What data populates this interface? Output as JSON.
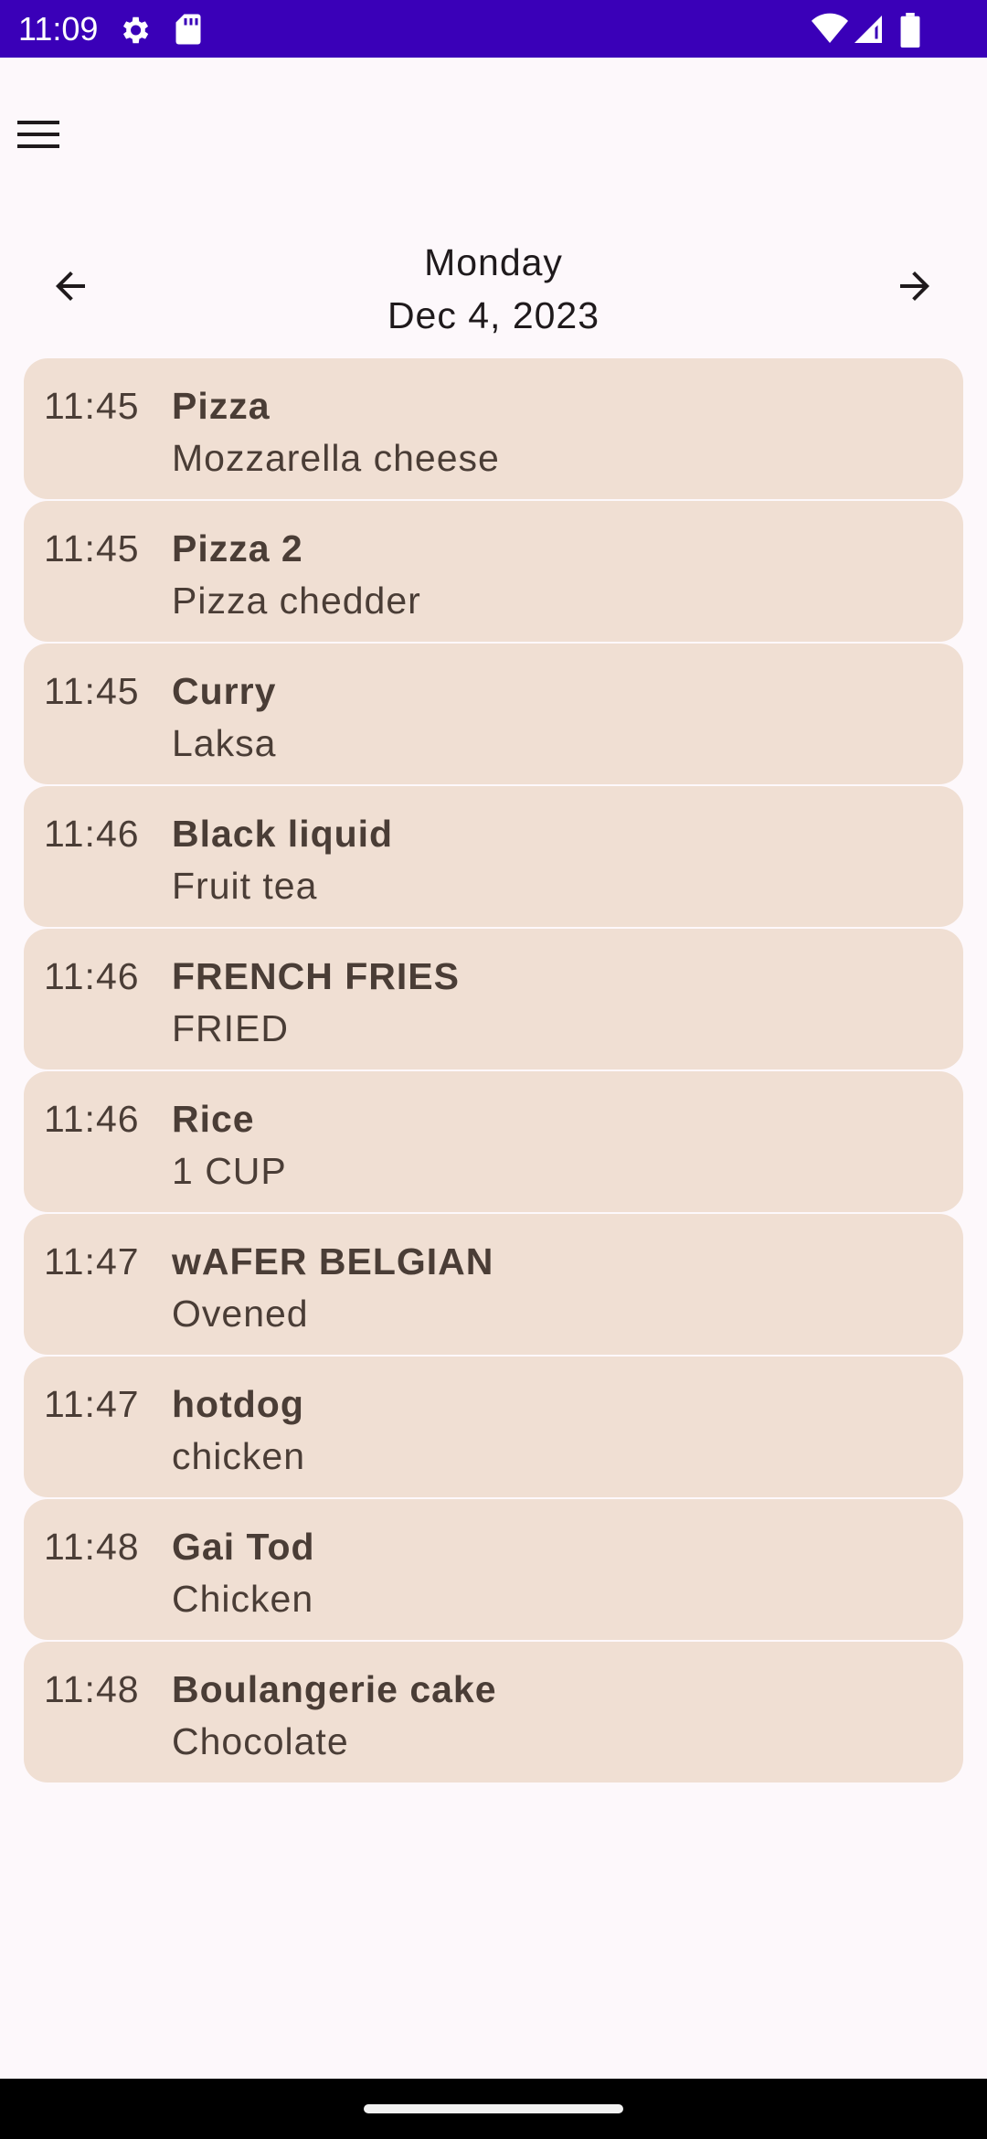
{
  "status_bar": {
    "time": "11:09",
    "icons": [
      "settings-gear-icon",
      "sd-card-icon",
      "wifi-icon",
      "cell-signal-icon",
      "battery-icon"
    ],
    "background": "#3a00b8"
  },
  "toolbar": {
    "menu_icon": "hamburger-menu-icon"
  },
  "date_nav": {
    "day": "Monday",
    "date": "Dec 4, 2023",
    "prev_icon": "arrow-back-icon",
    "next_icon": "arrow-forward-icon"
  },
  "entries": [
    {
      "time": "11:45",
      "title": "Pizza",
      "subtitle": "Mozzarella cheese"
    },
    {
      "time": "11:45",
      "title": "Pizza 2",
      "subtitle": "Pizza chedder"
    },
    {
      "time": "11:45",
      "title": "Curry",
      "subtitle": "Laksa"
    },
    {
      "time": "11:46",
      "title": "Black liquid",
      "subtitle": "Fruit tea"
    },
    {
      "time": "11:46",
      "title": "FRENCH FRIES",
      "subtitle": "FRIED"
    },
    {
      "time": "11:46",
      "title": "Rice",
      "subtitle": "1 CUP"
    },
    {
      "time": "11:47",
      "title": "wAFER BELGIAN",
      "subtitle": "Ovened"
    },
    {
      "time": "11:47",
      "title": "hotdog",
      "subtitle": "chicken"
    },
    {
      "time": "11:48",
      "title": "Gai Tod",
      "subtitle": "Chicken"
    },
    {
      "time": "11:48",
      "title": "Boulangerie cake",
      "subtitle": "Chocolate"
    }
  ],
  "colors": {
    "card_background": "#f0dfd3",
    "page_background": "#fdf8fb",
    "text": "#4a3d36"
  }
}
